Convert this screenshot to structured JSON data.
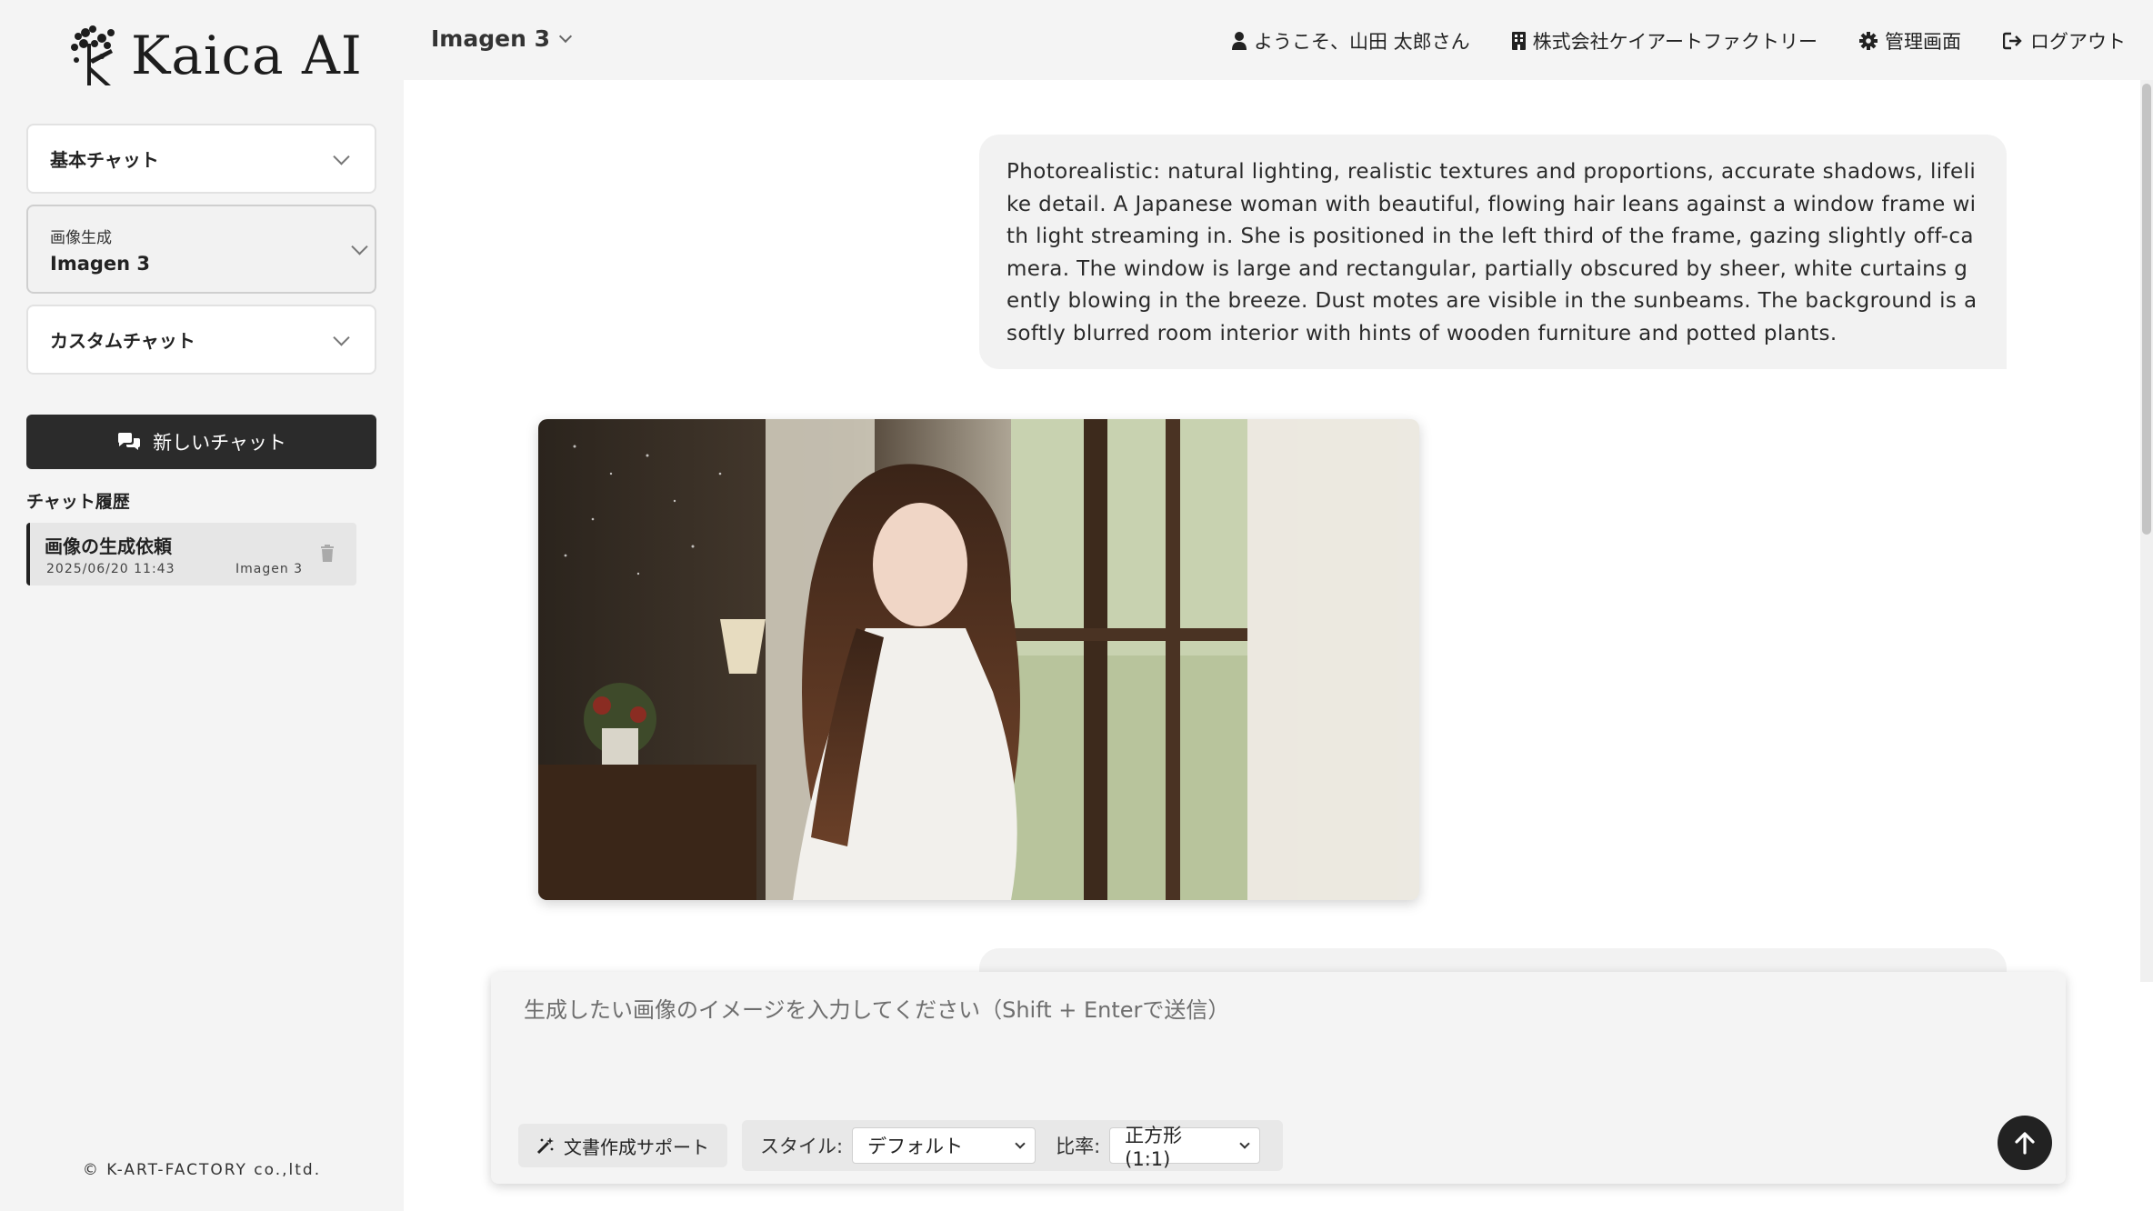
{
  "app": {
    "logo_text": "Kaica AI"
  },
  "sidebar": {
    "basic_chat_label": "基本チャット",
    "image_gen_label": "画像生成",
    "image_gen_model": "Imagen 3",
    "custom_chat_label": "カスタムチャット",
    "new_chat_label": "新しいチャット",
    "history_title": "チャット履歴",
    "history": [
      {
        "title": "画像の生成依頼",
        "date": "2025/06/20 11:43",
        "model": "Imagen 3"
      }
    ],
    "copyright": "© K-ART-FACTORY co.,ltd."
  },
  "header": {
    "model": "Imagen 3",
    "welcome": "ようこそ、山田 太郎さん",
    "company": "株式会社ケイアートファクトリー",
    "admin": "管理画面",
    "logout": "ログアウト"
  },
  "chat": {
    "user_prompt": "Photorealistic: natural lighting, realistic textures and proportions, accurate shadows, lifelike detail. A Japanese woman with beautiful, flowing hair leans against a window frame with light streaming in. She is positioned in the left third of the frame, gazing slightly off-camera. The window is large and rectangular, partially obscured by sheer, white curtains gently blowing in the breeze. Dust motes are visible in the sunbeams. The background is a softly blurred room interior with hints of wooden furniture and potted plants."
  },
  "composer": {
    "placeholder": "生成したい画像のイメージを入力してください（Shift + Enterで送信）",
    "support_label": "文書作成サポート",
    "style_label": "スタイル:",
    "style_value": "デフォルト",
    "ratio_label": "比率:",
    "ratio_value": "正方形 (1:1)"
  },
  "icons": {
    "chevron": "chevron-down-icon",
    "user": "user-icon",
    "building": "building-icon",
    "gear": "gear-icon",
    "logout": "logout-icon",
    "chat": "chat-bubbles-icon",
    "trash": "trash-icon",
    "wand": "magic-wand-icon",
    "send": "arrow-up-icon"
  },
  "colors": {
    "primary_dark": "#2b2b2b",
    "sidebar_bg": "#f4f4f4",
    "bubble_bg": "#f2f2f2"
  }
}
